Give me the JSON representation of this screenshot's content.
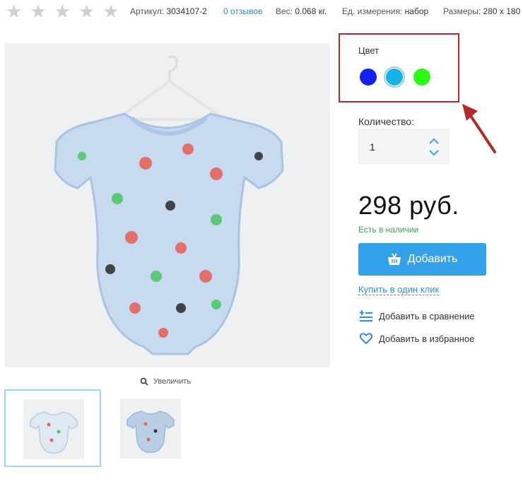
{
  "rating": {
    "stars_total": 5,
    "stars_filled": 0
  },
  "meta": {
    "article_label": "Артикул:",
    "article_value": "3034107-2",
    "reviews": "0 отзывов",
    "weight_label": "Вес:",
    "weight_value": "0.068 кг.",
    "unit_label": "Ед. измерения:",
    "unit_value": "набор",
    "size_label": "Размеры:",
    "size_value": "280 x 180"
  },
  "gallery": {
    "zoom_label": "Увеличить"
  },
  "color": {
    "title": "Цвет",
    "options": [
      {
        "name": "blue",
        "hex": "#0f22f2"
      },
      {
        "name": "cyan",
        "hex": "#16b4e4"
      },
      {
        "name": "green",
        "hex": "#2dfa14"
      }
    ],
    "selected_index": 1,
    "highlight_color": "#b22a2a"
  },
  "quantity": {
    "label": "Количество:",
    "value": "1"
  },
  "price": {
    "text": "298 руб."
  },
  "stock": {
    "text": "Есть в наличии"
  },
  "buttons": {
    "add": "Добавить",
    "one_click": "Купить в один клик",
    "compare": "Добавить в сравнение",
    "favorite": "Добавить в избранное"
  },
  "colors": {
    "accent": "#34a2e8",
    "link": "#2f8fd6",
    "stock": "#3aa45d"
  }
}
